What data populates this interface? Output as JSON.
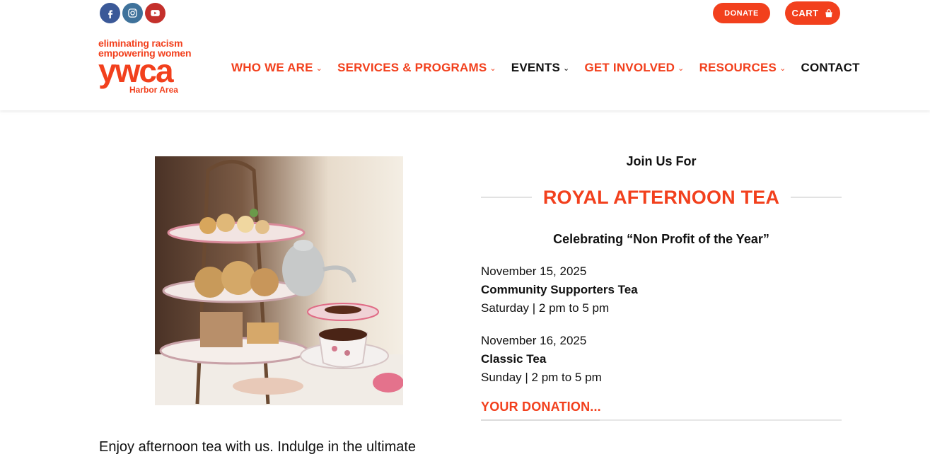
{
  "header": {
    "social": [
      "facebook-icon",
      "instagram-icon",
      "youtube-icon"
    ],
    "donate_label": "DONATE",
    "cart_label": "CART"
  },
  "logo": {
    "line1": "eliminating racism",
    "line2": "empowering women",
    "word": "ywca",
    "area": "Harbor Area"
  },
  "nav": {
    "items": [
      {
        "label": "WHO WE ARE",
        "dropdown": true
      },
      {
        "label": "SERVICES & PROGRAMS",
        "dropdown": true
      },
      {
        "label": "EVENTS",
        "dropdown": true
      },
      {
        "label": "GET INVOLVED",
        "dropdown": true
      },
      {
        "label": "RESOURCES",
        "dropdown": true
      },
      {
        "label": "CONTACT",
        "dropdown": false
      }
    ]
  },
  "content": {
    "join": "Join Us For",
    "title": "ROYAL AFTERNOON TEA",
    "celebrating": "Celebrating “Non Profit of the Year”",
    "events": [
      {
        "date": "November 15, 2025",
        "name": "Community Supporters Tea",
        "time": "Saturday | 2 pm to 5 pm"
      },
      {
        "date": "November 16, 2025",
        "name": "Classic Tea",
        "time": "Sunday | 2 pm to 5 pm"
      }
    ],
    "donation_label": "YOUR DONATION...",
    "intro": "Enjoy afternoon tea with us. Indulge in the ultimate"
  },
  "colors": {
    "accent": "#f2401d",
    "facebook": "#3b5998",
    "instagram": "#3f729b",
    "youtube": "#c4302b"
  }
}
